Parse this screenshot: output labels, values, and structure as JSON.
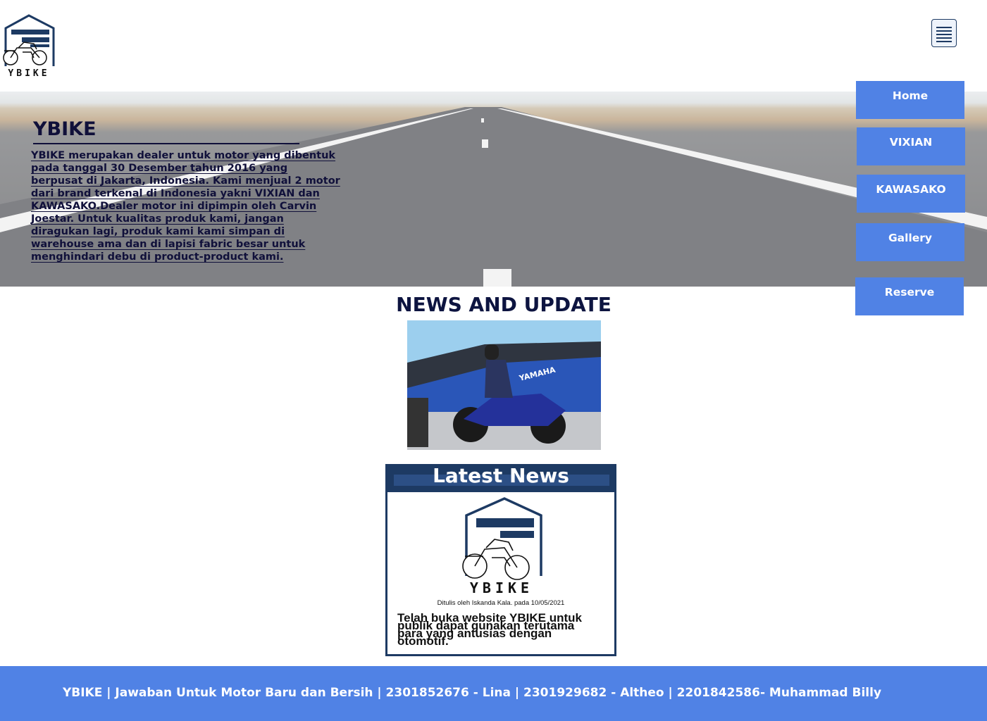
{
  "brand": {
    "logo_text": "YBIKE"
  },
  "hero": {
    "title": "YBIKE",
    "description": "YBIKE merupakan dealer untuk motor yang dibentuk pada tanggal 30 Desember tahun 2016 yang berpusat di Jakarta, Indonesia. Kami menjual 2 motor dari brand terkenal di Indonesia yakni VIXIAN dan KAWASAKO.Dealer motor ini dipimpin oleh Carvin Joestar. Untuk kualitas produk kami, jangan diragukan lagi, produk kami kami simpan di warehouse ama dan di lapisi fabric besar untuk menghindari debu di product-product kami."
  },
  "nav": {
    "items": [
      {
        "label": "Home"
      },
      {
        "label": "VIXIAN"
      },
      {
        "label": "KAWASAKO"
      },
      {
        "label": "Gallery"
      },
      {
        "label": "Reserve"
      }
    ]
  },
  "news": {
    "heading": "NEWS AND UPDATE",
    "photo_banner_text": "YAMAHA",
    "card": {
      "title": "Latest News",
      "logo_text": "YBIKE",
      "byline": "Ditulis oleh Iskanda Kala. pada 10/05/2021",
      "text": "Telah buka website YBIKE untuk publik dapat gunakan terutama para yang antusias dengan otomotif."
    }
  },
  "footer": {
    "text": "YBIKE | Jawaban Untuk Motor Baru dan Bersih | 2301852676 - Lina | 2301929682 - Altheo | 2201842586- Muhammad Billy"
  },
  "colors": {
    "primary_blue": "#5082e5",
    "navy": "#1d3a63",
    "dark_text": "#10103a"
  },
  "icons": [
    "menu-icon",
    "garage-motorbike-logo"
  ]
}
